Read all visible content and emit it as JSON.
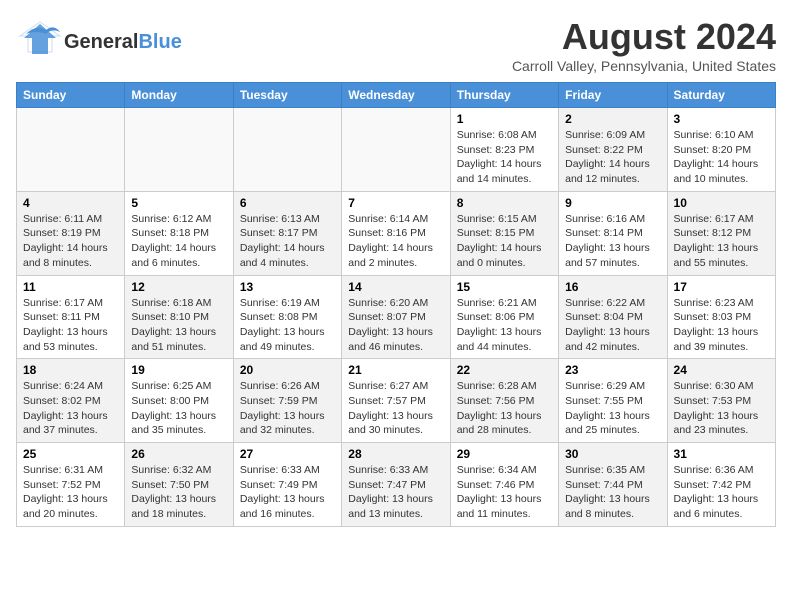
{
  "header": {
    "logo_general": "General",
    "logo_blue": "Blue",
    "month_year": "August 2024",
    "location": "Carroll Valley, Pennsylvania, United States"
  },
  "days_of_week": [
    "Sunday",
    "Monday",
    "Tuesday",
    "Wednesday",
    "Thursday",
    "Friday",
    "Saturday"
  ],
  "weeks": [
    [
      {
        "day": "",
        "info": "",
        "empty": true
      },
      {
        "day": "",
        "info": "",
        "empty": true
      },
      {
        "day": "",
        "info": "",
        "empty": true
      },
      {
        "day": "",
        "info": "",
        "empty": true
      },
      {
        "day": "1",
        "info": "Sunrise: 6:08 AM\nSunset: 8:23 PM\nDaylight: 14 hours\nand 14 minutes.",
        "shaded": false
      },
      {
        "day": "2",
        "info": "Sunrise: 6:09 AM\nSunset: 8:22 PM\nDaylight: 14 hours\nand 12 minutes.",
        "shaded": true
      },
      {
        "day": "3",
        "info": "Sunrise: 6:10 AM\nSunset: 8:20 PM\nDaylight: 14 hours\nand 10 minutes.",
        "shaded": false
      }
    ],
    [
      {
        "day": "4",
        "info": "Sunrise: 6:11 AM\nSunset: 8:19 PM\nDaylight: 14 hours\nand 8 minutes.",
        "shaded": true
      },
      {
        "day": "5",
        "info": "Sunrise: 6:12 AM\nSunset: 8:18 PM\nDaylight: 14 hours\nand 6 minutes.",
        "shaded": false
      },
      {
        "day": "6",
        "info": "Sunrise: 6:13 AM\nSunset: 8:17 PM\nDaylight: 14 hours\nand 4 minutes.",
        "shaded": true
      },
      {
        "day": "7",
        "info": "Sunrise: 6:14 AM\nSunset: 8:16 PM\nDaylight: 14 hours\nand 2 minutes.",
        "shaded": false
      },
      {
        "day": "8",
        "info": "Sunrise: 6:15 AM\nSunset: 8:15 PM\nDaylight: 14 hours\nand 0 minutes.",
        "shaded": true
      },
      {
        "day": "9",
        "info": "Sunrise: 6:16 AM\nSunset: 8:14 PM\nDaylight: 13 hours\nand 57 minutes.",
        "shaded": false
      },
      {
        "day": "10",
        "info": "Sunrise: 6:17 AM\nSunset: 8:12 PM\nDaylight: 13 hours\nand 55 minutes.",
        "shaded": true
      }
    ],
    [
      {
        "day": "11",
        "info": "Sunrise: 6:17 AM\nSunset: 8:11 PM\nDaylight: 13 hours\nand 53 minutes.",
        "shaded": false
      },
      {
        "day": "12",
        "info": "Sunrise: 6:18 AM\nSunset: 8:10 PM\nDaylight: 13 hours\nand 51 minutes.",
        "shaded": true
      },
      {
        "day": "13",
        "info": "Sunrise: 6:19 AM\nSunset: 8:08 PM\nDaylight: 13 hours\nand 49 minutes.",
        "shaded": false
      },
      {
        "day": "14",
        "info": "Sunrise: 6:20 AM\nSunset: 8:07 PM\nDaylight: 13 hours\nand 46 minutes.",
        "shaded": true
      },
      {
        "day": "15",
        "info": "Sunrise: 6:21 AM\nSunset: 8:06 PM\nDaylight: 13 hours\nand 44 minutes.",
        "shaded": false
      },
      {
        "day": "16",
        "info": "Sunrise: 6:22 AM\nSunset: 8:04 PM\nDaylight: 13 hours\nand 42 minutes.",
        "shaded": true
      },
      {
        "day": "17",
        "info": "Sunrise: 6:23 AM\nSunset: 8:03 PM\nDaylight: 13 hours\nand 39 minutes.",
        "shaded": false
      }
    ],
    [
      {
        "day": "18",
        "info": "Sunrise: 6:24 AM\nSunset: 8:02 PM\nDaylight: 13 hours\nand 37 minutes.",
        "shaded": true
      },
      {
        "day": "19",
        "info": "Sunrise: 6:25 AM\nSunset: 8:00 PM\nDaylight: 13 hours\nand 35 minutes.",
        "shaded": false
      },
      {
        "day": "20",
        "info": "Sunrise: 6:26 AM\nSunset: 7:59 PM\nDaylight: 13 hours\nand 32 minutes.",
        "shaded": true
      },
      {
        "day": "21",
        "info": "Sunrise: 6:27 AM\nSunset: 7:57 PM\nDaylight: 13 hours\nand 30 minutes.",
        "shaded": false
      },
      {
        "day": "22",
        "info": "Sunrise: 6:28 AM\nSunset: 7:56 PM\nDaylight: 13 hours\nand 28 minutes.",
        "shaded": true
      },
      {
        "day": "23",
        "info": "Sunrise: 6:29 AM\nSunset: 7:55 PM\nDaylight: 13 hours\nand 25 minutes.",
        "shaded": false
      },
      {
        "day": "24",
        "info": "Sunrise: 6:30 AM\nSunset: 7:53 PM\nDaylight: 13 hours\nand 23 minutes.",
        "shaded": true
      }
    ],
    [
      {
        "day": "25",
        "info": "Sunrise: 6:31 AM\nSunset: 7:52 PM\nDaylight: 13 hours\nand 20 minutes.",
        "shaded": false
      },
      {
        "day": "26",
        "info": "Sunrise: 6:32 AM\nSunset: 7:50 PM\nDaylight: 13 hours\nand 18 minutes.",
        "shaded": true
      },
      {
        "day": "27",
        "info": "Sunrise: 6:33 AM\nSunset: 7:49 PM\nDaylight: 13 hours\nand 16 minutes.",
        "shaded": false
      },
      {
        "day": "28",
        "info": "Sunrise: 6:33 AM\nSunset: 7:47 PM\nDaylight: 13 hours\nand 13 minutes.",
        "shaded": true
      },
      {
        "day": "29",
        "info": "Sunrise: 6:34 AM\nSunset: 7:46 PM\nDaylight: 13 hours\nand 11 minutes.",
        "shaded": false
      },
      {
        "day": "30",
        "info": "Sunrise: 6:35 AM\nSunset: 7:44 PM\nDaylight: 13 hours\nand 8 minutes.",
        "shaded": true
      },
      {
        "day": "31",
        "info": "Sunrise: 6:36 AM\nSunset: 7:42 PM\nDaylight: 13 hours\nand 6 minutes.",
        "shaded": false
      }
    ]
  ]
}
